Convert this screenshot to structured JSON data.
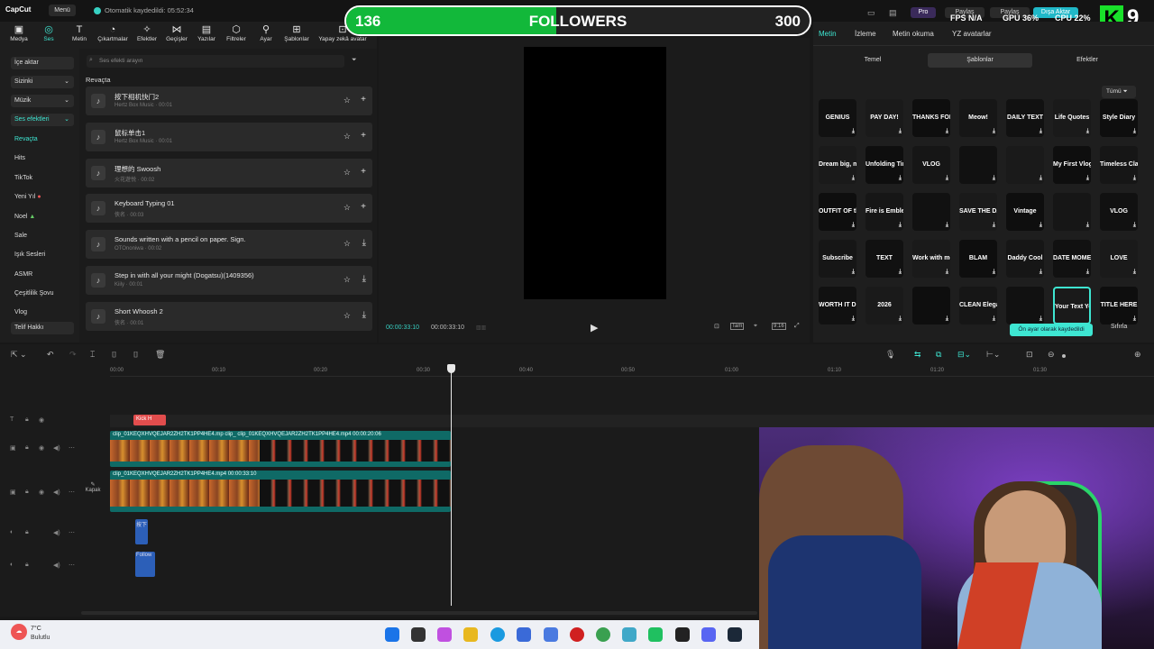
{
  "app": {
    "logo": "CapCut",
    "menu": "Menü",
    "save_status": "Otomatik kaydedildi: 05:52:34"
  },
  "toolbar": [
    "Medya",
    "Ses",
    "Metin",
    "Çıkartmalar",
    "Efektler",
    "Geçişler",
    "Yazılar",
    "Filtreler",
    "Ayar",
    "Şablonlar",
    "Yapay zekâ avatar"
  ],
  "sidebar": {
    "import": "İçe aktar",
    "yours": "Sizinki",
    "music": "Müzik",
    "sfx": "Ses efektleri",
    "items": [
      "Revaçta",
      "Hits",
      "TikTok",
      "Yeni Yıl",
      "Noel",
      "Sale",
      "Işık Sesleri",
      "ASMR",
      "Çeşitlilik Şovu",
      "Vlog"
    ],
    "copyright": "Telif Hakkı"
  },
  "list": {
    "search_placeholder": "Ses efekti arayın",
    "section": "Revaçta",
    "items": [
      {
        "title": "按下相机快门2",
        "sub": "Hertz Box Music · 00:01"
      },
      {
        "title": "鼠标单击1",
        "sub": "Hertz Box Music · 00:01"
      },
      {
        "title": "理想的 Swoosh",
        "sub": "火花遊悦 · 00:02"
      },
      {
        "title": "Keyboard Typing 01",
        "sub": "侠名 · 00:03"
      },
      {
        "title": "Sounds written with a pencil on paper. Sign.",
        "sub": "OTOnoniwa · 00:02"
      },
      {
        "title": "Step in with all your might (Dogatsu)(1409356)",
        "sub": "Kiily · 00:01"
      },
      {
        "title": "Short Whoosh 2",
        "sub": "侠名 · 00:01"
      }
    ]
  },
  "player": {
    "current": "00:00:33:10",
    "total": "00:00:33:10",
    "ratio": "Tam",
    "aspect": "9:16"
  },
  "overlay": {
    "left": "136",
    "label": "FOLLOWERS",
    "right": "300",
    "progress": 0.453,
    "color": "#12b83a"
  },
  "hud": {
    "pro": "Pro",
    "share": "Paylaş",
    "share2": "Paylaş",
    "export": "Dışa Aktar",
    "fps": "FPS N/A",
    "gpu": "GPU 36%",
    "cpu": "CPU 22%",
    "badge": "9"
  },
  "right": {
    "tabs": [
      "Metin",
      "İzleme",
      "Metin okuma",
      "YZ avatarlar"
    ],
    "segs": [
      "Temel",
      "Şablonlar",
      "Efektler"
    ],
    "filter": "Tümü",
    "templates": [
      [
        "GENIUS",
        "PAY DAY!",
        "THANKS FOR WATCHING",
        "Meow!",
        "DAILY TEXT",
        "Life Quotes",
        "Style Diary"
      ],
      [
        "Dream big, make it happen",
        "Unfolding Timeline",
        "VLOG",
        "",
        "",
        "My First Vlog",
        "Timeless Classic"
      ],
      [
        "OUTFIT OF the day",
        "Fire is Emblem",
        "",
        "SAVE THE DATE",
        "Vintage",
        "",
        "VLOG"
      ],
      [
        "Subscribe",
        "TEXT",
        "Work with me",
        "BLAM",
        "Daddy Cool",
        "DATE MOMENT",
        "LOVE"
      ],
      [
        "WORTH IT DI VERDAD",
        "2026",
        "",
        "CLEAN Elegant",
        "",
        "Your Text Your Title Your Quote",
        "TITLE HERE"
      ]
    ],
    "default_btn": "Ön ayar olarak kaydedildi",
    "reset_btn": "Sıfırla"
  },
  "timeline": {
    "ruler": [
      "00:00",
      "00:10",
      "00:20",
      "00:30",
      "00:40",
      "00:50",
      "01:00",
      "01:10",
      "01:20",
      "01:30"
    ],
    "caption_clip": "Kick H",
    "clip1_a": "clip_01KEQXHVQEJAR2ZH2TK1PP4HE4.mp",
    "clip1_b": "clip_",
    "clip1_c": "clip_01KEQXHVQEJAR2ZH2TK1PP4HE4.mp4  00:00:20:06",
    "clip2": "clip_01KEQXHVQEJAR2ZH2TK1PP4HE4.mp4  00:00:33:10",
    "cover": "Kapak",
    "audio1": "按下",
    "audio2": "Follow"
  },
  "taskbar": {
    "temp": "7°C",
    "weather": "Bulutlu"
  }
}
